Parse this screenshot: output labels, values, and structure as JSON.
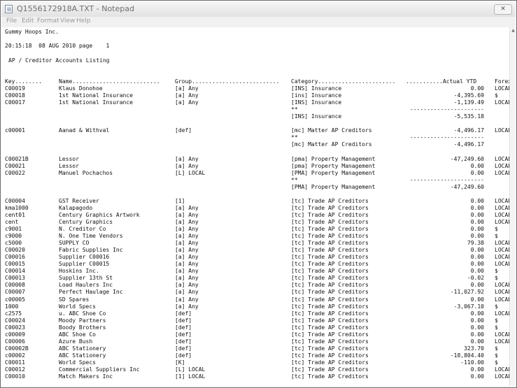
{
  "window": {
    "title": "Q1556172918A.TXT - Notepad",
    "minimize_glyph": "–",
    "close_glyph": "✕",
    "scroll_up_glyph": "▲"
  },
  "menu": [
    "File",
    "Edit",
    "Format",
    "View",
    "Help"
  ],
  "report": {
    "company": "Gummy Hoops Inc.",
    "timestamp": "20:15:18  08 AUG 2010 page    1",
    "title": "AP / Creditor Accounts Listing"
  },
  "columns": {
    "key": "Key........",
    "name": "Name..........................",
    "group": "Group..........................",
    "category": "Category.......................",
    "ytd": "...........Actual YTD",
    "forex": "Forex."
  },
  "rows": [
    {
      "t": "r",
      "key": "C00019",
      "name": "Klaus Donohoe",
      "group": "[a] Any",
      "cat": "[INS] Insurance",
      "ytd": "0.00",
      "fx": "LOCAL"
    },
    {
      "t": "r",
      "key": "C00018",
      "name": "1st National Insurance",
      "group": "[a] Any",
      "cat": "[ins] Insurance",
      "ytd": "-4,395.69",
      "fx": "$"
    },
    {
      "t": "r",
      "key": "C00017",
      "name": "1st National Insurance",
      "group": "[a] Any",
      "cat": "[INS] Insurance",
      "ytd": "-1,139.49",
      "fx": "LOCAL"
    },
    {
      "t": "r",
      "cat": "**",
      "ytd": "----------------------"
    },
    {
      "t": "r",
      "cat": "[INS] Insurance",
      "ytd": "-5,535.18"
    },
    {
      "t": "b"
    },
    {
      "t": "r",
      "key": "c00001",
      "name": "Aanad & Withval",
      "group": "[def]",
      "cat": "[mc] Matter AP Creditors",
      "ytd": "-4,496.17",
      "fx": "LOCAL"
    },
    {
      "t": "r",
      "cat": "**",
      "ytd": "----------------------"
    },
    {
      "t": "r",
      "cat": "[mc] Matter AP Creditors",
      "ytd": "-4,496.17"
    },
    {
      "t": "b"
    },
    {
      "t": "r",
      "key": "C00021B",
      "name": "Lessor",
      "group": "[a] Any",
      "cat": "[pma] Property Management",
      "ytd": "-47,249.60",
      "fx": "LOCAL"
    },
    {
      "t": "r",
      "key": "C00021",
      "name": "Lessor",
      "group": "[a] Any",
      "cat": "[pma] Property Management",
      "ytd": "0.00",
      "fx": "LOCAL"
    },
    {
      "t": "r",
      "key": "C00022",
      "name": "Manuel Pochachos",
      "group": "[L] LOCAL",
      "cat": "[PMA] Property Management",
      "ytd": "0.00",
      "fx": "LOCAL"
    },
    {
      "t": "r",
      "cat": "**",
      "ytd": "----------------------"
    },
    {
      "t": "r",
      "cat": "[PMA] Property Management",
      "ytd": "-47,249.60"
    },
    {
      "t": "b"
    },
    {
      "t": "r",
      "key": "C00004",
      "name": "GST Receiver",
      "group": "[1]",
      "cat": "[tc] Trade AP Creditors",
      "ytd": "0.00",
      "fx": "LOCAL"
    },
    {
      "t": "r",
      "key": "kma1000",
      "name": "Kalapagodo",
      "group": "[a] Any",
      "cat": "[tc] Trade AP Creditors",
      "ytd": "0.00",
      "fx": "LOCAL"
    },
    {
      "t": "r",
      "key": "cent01",
      "name": "Century Graphics Artwork",
      "group": "[a] Any",
      "cat": "[tc] Trade AP Creditors",
      "ytd": "0.00",
      "fx": "LOCAL"
    },
    {
      "t": "r",
      "key": "cent",
      "name": "Century Graphics",
      "group": "[a] Any",
      "cat": "[tc] Trade AP Creditors",
      "ytd": "0.00",
      "fx": "LOCAL"
    },
    {
      "t": "r",
      "key": "c9001",
      "name": "N. Creditor Co",
      "group": "[a] Any",
      "cat": "[tc] Trade AP Creditors",
      "ytd": "0.00",
      "fx": "$"
    },
    {
      "t": "r",
      "key": "c9000",
      "name": "N. One Time Vendors",
      "group": "[a] Any",
      "cat": "[tc] Trade AP Creditors",
      "ytd": "0.00",
      "fx": "$"
    },
    {
      "t": "r",
      "key": "c5000",
      "name": "SUPPLY CO",
      "group": "[a] Any",
      "cat": "[tc] Trade AP Creditors",
      "ytd": "79.38",
      "fx": "LOCAL"
    },
    {
      "t": "r",
      "key": "C00020",
      "name": "Fabric Supplies Inc",
      "group": "[a] Any",
      "cat": "[tc] Trade AP Creditors",
      "ytd": "0.00",
      "fx": "LOCAL"
    },
    {
      "t": "r",
      "key": "C00016",
      "name": "Supplier C00016",
      "group": "[a] Any",
      "cat": "[tc] Trade AP Creditors",
      "ytd": "0.00",
      "fx": "LOCAL"
    },
    {
      "t": "r",
      "key": "C00015",
      "name": "Supplier C00015",
      "group": "[a] Any",
      "cat": "[tc] Trade AP Creditors",
      "ytd": "0.00",
      "fx": "LOCAL"
    },
    {
      "t": "r",
      "key": "C00014",
      "name": "Hoskins Inc.",
      "group": "[a] Any",
      "cat": "[tc] Trade AP Creditors",
      "ytd": "0.00",
      "fx": "$"
    },
    {
      "t": "r",
      "key": "C00013",
      "name": "Supplier 13th St",
      "group": "[a] Any",
      "cat": "[tc] Trade AP Creditors",
      "ytd": "-0.02",
      "fx": "$"
    },
    {
      "t": "r",
      "key": "C00008",
      "name": "Load Haulers Inc",
      "group": "[a] Any",
      "cat": "[tc] Trade AP Creditors",
      "ytd": "0.00",
      "fx": "LOCAL"
    },
    {
      "t": "r",
      "key": "C00007",
      "name": "Perfect Haulage Inc",
      "group": "[a] Any",
      "cat": "[tc] Trade AP Creditors",
      "ytd": "-11,027.92",
      "fx": "LOCAL"
    },
    {
      "t": "r",
      "key": "c00005",
      "name": "SD Spares",
      "group": "[a] Any",
      "cat": "[tc] Trade AP Creditors",
      "ytd": "0.00",
      "fx": "LOCAL"
    },
    {
      "t": "r",
      "key": "1000",
      "name": "World Specs",
      "group": "[a] Any",
      "cat": "[tc] Trade AP Creditors",
      "ytd": "-3,067.10",
      "fx": "$"
    },
    {
      "t": "r",
      "key": "c2575",
      "name": "u. ABC Shoe Co",
      "group": "[def]",
      "cat": "[tc] Trade AP Creditors",
      "ytd": "0.00",
      "fx": "LOCAL"
    },
    {
      "t": "r",
      "key": "C00024",
      "name": "Moody Partners",
      "group": "[def]",
      "cat": "[tc] Trade AP Creditors",
      "ytd": "0.00",
      "fx": "$"
    },
    {
      "t": "r",
      "key": "C00023",
      "name": "Boody Brothers",
      "group": "[def]",
      "cat": "[tc] Trade AP Creditors",
      "ytd": "0.00",
      "fx": "$"
    },
    {
      "t": "r",
      "key": "c00009",
      "name": "ABC Shoe Co",
      "group": "[def]",
      "cat": "[tc] Trade AP Creditors",
      "ytd": "0.00",
      "fx": "LOCAL"
    },
    {
      "t": "r",
      "key": "C00006",
      "name": "Azure Bush",
      "group": "[def]",
      "cat": "[tc] Trade AP Creditors",
      "ytd": "0.00",
      "fx": "LOCAL"
    },
    {
      "t": "r",
      "key": "C00002B",
      "name": "ABC Stationery",
      "group": "[def]",
      "cat": "[tc] Trade AP Creditors",
      "ytd": "323.70",
      "fx": "$"
    },
    {
      "t": "r",
      "key": "c00002",
      "name": "ABC Stationery",
      "group": "[def]",
      "cat": "[tc] Trade AP Creditors",
      "ytd": "-18,804.40",
      "fx": "$"
    },
    {
      "t": "r",
      "key": "C00011",
      "name": "World Specs",
      "group": "[K]",
      "cat": "[tc] Trade AP Creditors",
      "ytd": "-110.00",
      "fx": "$"
    },
    {
      "t": "r",
      "key": "C00012",
      "name": "Commercial Suppliers Inc",
      "group": "[L] LOCAL",
      "cat": "[tc] Trade AP Creditors",
      "ytd": "0.00",
      "fx": "LOCAL"
    },
    {
      "t": "r",
      "key": "C00010",
      "name": "Match Makers Inc",
      "group": "[1] LOCAL",
      "cat": "[tc] Trade AP Creditors",
      "ytd": "0.00",
      "fx": "LOCAL"
    }
  ]
}
